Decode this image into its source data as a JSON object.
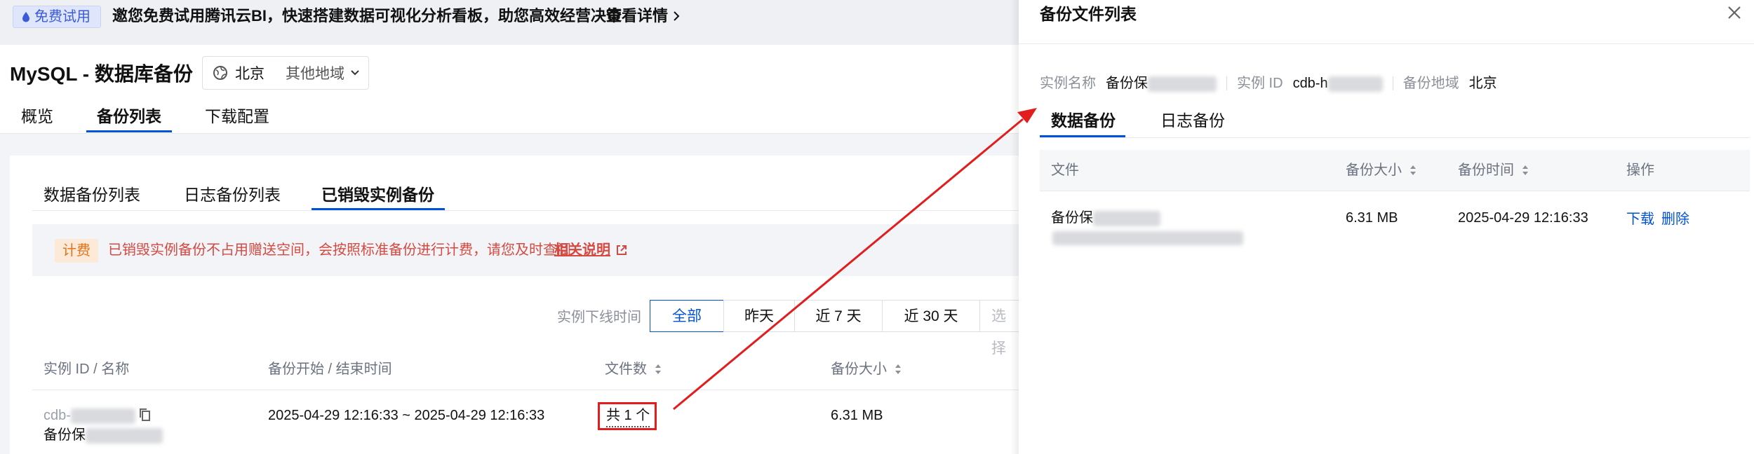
{
  "promo": {
    "tag": "免费试用",
    "text": "邀您免费试用腾讯云BI，快速搭建数据可视化分析看板，助您高效经营决策",
    "link": "查看详情"
  },
  "header": {
    "title": "MySQL - 数据库备份",
    "region": {
      "current": "北京",
      "other": "其他地域"
    },
    "tabs": [
      {
        "label": "概览"
      },
      {
        "label": "备份列表",
        "active": true
      },
      {
        "label": "下载配置"
      }
    ]
  },
  "subtabs": [
    {
      "label": "数据备份列表"
    },
    {
      "label": "日志备份列表"
    },
    {
      "label": "已销毁实例备份",
      "active": true
    }
  ],
  "alert": {
    "tag": "计费",
    "text": "已销毁实例备份不占用赠送空间，会按照标准备份进行计费，请您及时查阅",
    "link": "相关说明"
  },
  "filter": {
    "label": "实例下线时间",
    "options": [
      {
        "label": "全部",
        "active": true
      },
      {
        "label": "昨天"
      },
      {
        "label": "近 7 天"
      },
      {
        "label": "近 30 天"
      },
      {
        "label": "选择"
      }
    ]
  },
  "table": {
    "columns": [
      "实例 ID / 名称",
      "备份开始 / 结束时间",
      "文件数",
      "备份大小"
    ],
    "rows": [
      {
        "instance_id": "cdb-",
        "instance_name": "备份保",
        "time_range": "2025-04-29 12:16:33 ~ 2025-04-29 12:16:33",
        "file_count": "共 1 个",
        "size": "6.31 MB"
      }
    ]
  },
  "drawer": {
    "title": "备份文件列表",
    "meta": {
      "name_label": "实例名称",
      "name_value": "备份保",
      "id_label": "实例 ID",
      "id_value": "cdb-h",
      "region_label": "备份地域",
      "region_value": "北京"
    },
    "tabs": [
      {
        "label": "数据备份",
        "active": true
      },
      {
        "label": "日志备份"
      }
    ],
    "columns": [
      "文件",
      "备份大小",
      "备份时间",
      "操作"
    ],
    "rows": [
      {
        "file_name": "备份保",
        "size": "6.31 MB",
        "time": "2025-04-29 12:16:33",
        "actions": [
          "下载",
          "删除"
        ]
      }
    ]
  },
  "colors": {
    "accent": "#0052d9",
    "annotation_red": "#e11d1d",
    "alert_text": "#d54941",
    "fee_tag": "#e37318"
  }
}
